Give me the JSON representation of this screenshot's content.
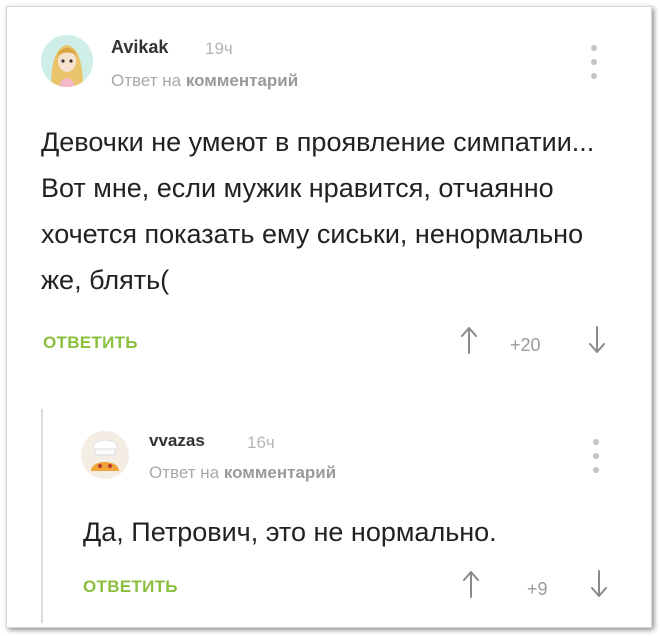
{
  "comments": [
    {
      "username": "Avikak",
      "time": "19ч",
      "reply_prefix": "Ответ на",
      "reply_target": "комментарий",
      "text": "Девочки не умеют в проявление симпатии... Вот мне, если мужик нравится, отчаянно хочется показать ему сиськи, ненормально же, блять(",
      "reply_label": "ОТВЕТИТЬ",
      "score": "+20"
    },
    {
      "username": "vvazas",
      "time": "16ч",
      "reply_prefix": "Ответ на",
      "reply_target": "комментарий",
      "text": "Да, Петрович, это не нормально.",
      "reply_label": "ОТВЕТИТЬ",
      "score": "+9"
    }
  ],
  "colors": {
    "accent_green": "#8bbf3e",
    "muted_gray": "#a8a8a8"
  },
  "icons": {
    "avatar_1": "anime-girl-avatar",
    "avatar_2": "chef-hat-cartoon-avatar",
    "menu": "vertical-dots-icon",
    "vote_up": "arrow-up-icon",
    "vote_down": "arrow-down-icon"
  }
}
